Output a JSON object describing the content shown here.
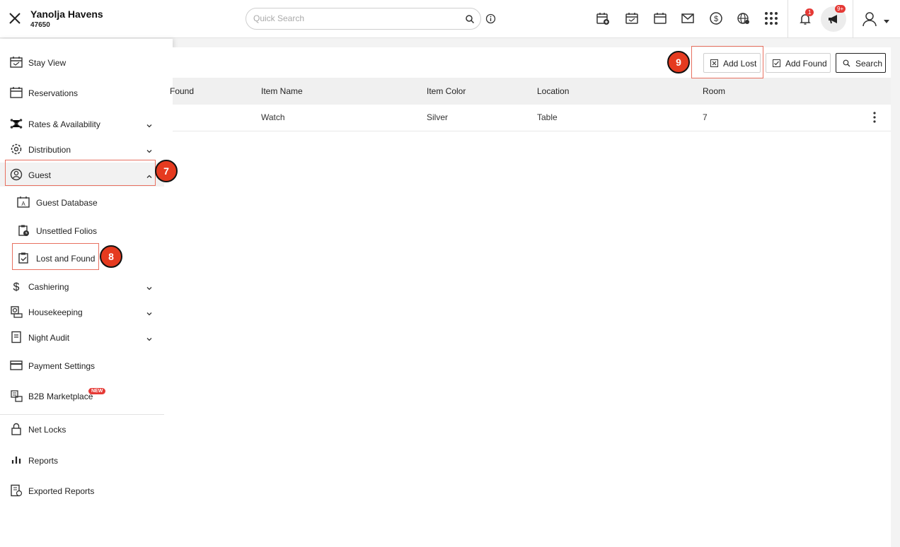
{
  "header": {
    "hotel_name": "Yanolja Havens",
    "hotel_id": "47650",
    "search_placeholder": "Quick Search",
    "notification_count": "1",
    "announcement_count": "9+"
  },
  "sidebar": {
    "items": [
      {
        "label": "Stay View"
      },
      {
        "label": "Reservations"
      },
      {
        "label": "Rates & Availability"
      },
      {
        "label": "Distribution"
      },
      {
        "label": "Guest"
      },
      {
        "label": "Guest Database"
      },
      {
        "label": "Unsettled Folios"
      },
      {
        "label": "Lost and Found"
      },
      {
        "label": "Cashiering"
      },
      {
        "label": "Housekeeping"
      },
      {
        "label": "Night Audit"
      },
      {
        "label": "Payment Settings"
      },
      {
        "label": "B2B Marketplace"
      },
      {
        "label": "Net Locks"
      },
      {
        "label": "Reports"
      },
      {
        "label": "Exported Reports"
      }
    ],
    "new_badge": "NEW"
  },
  "main": {
    "buttons": {
      "add_lost": "Add Lost",
      "add_found": "Add Found",
      "search": "Search"
    },
    "table": {
      "headers": [
        "Found",
        "Item Name",
        "Item Color",
        "Location",
        "Room"
      ],
      "rows": [
        {
          "item_name": "Watch",
          "item_color": "Silver",
          "location": "Table",
          "room": "7"
        }
      ]
    }
  },
  "annotations": {
    "step7": "7",
    "step8": "8",
    "step9": "9"
  },
  "colors": {
    "accent_red": "#e53935",
    "highlight": "#e87060"
  }
}
